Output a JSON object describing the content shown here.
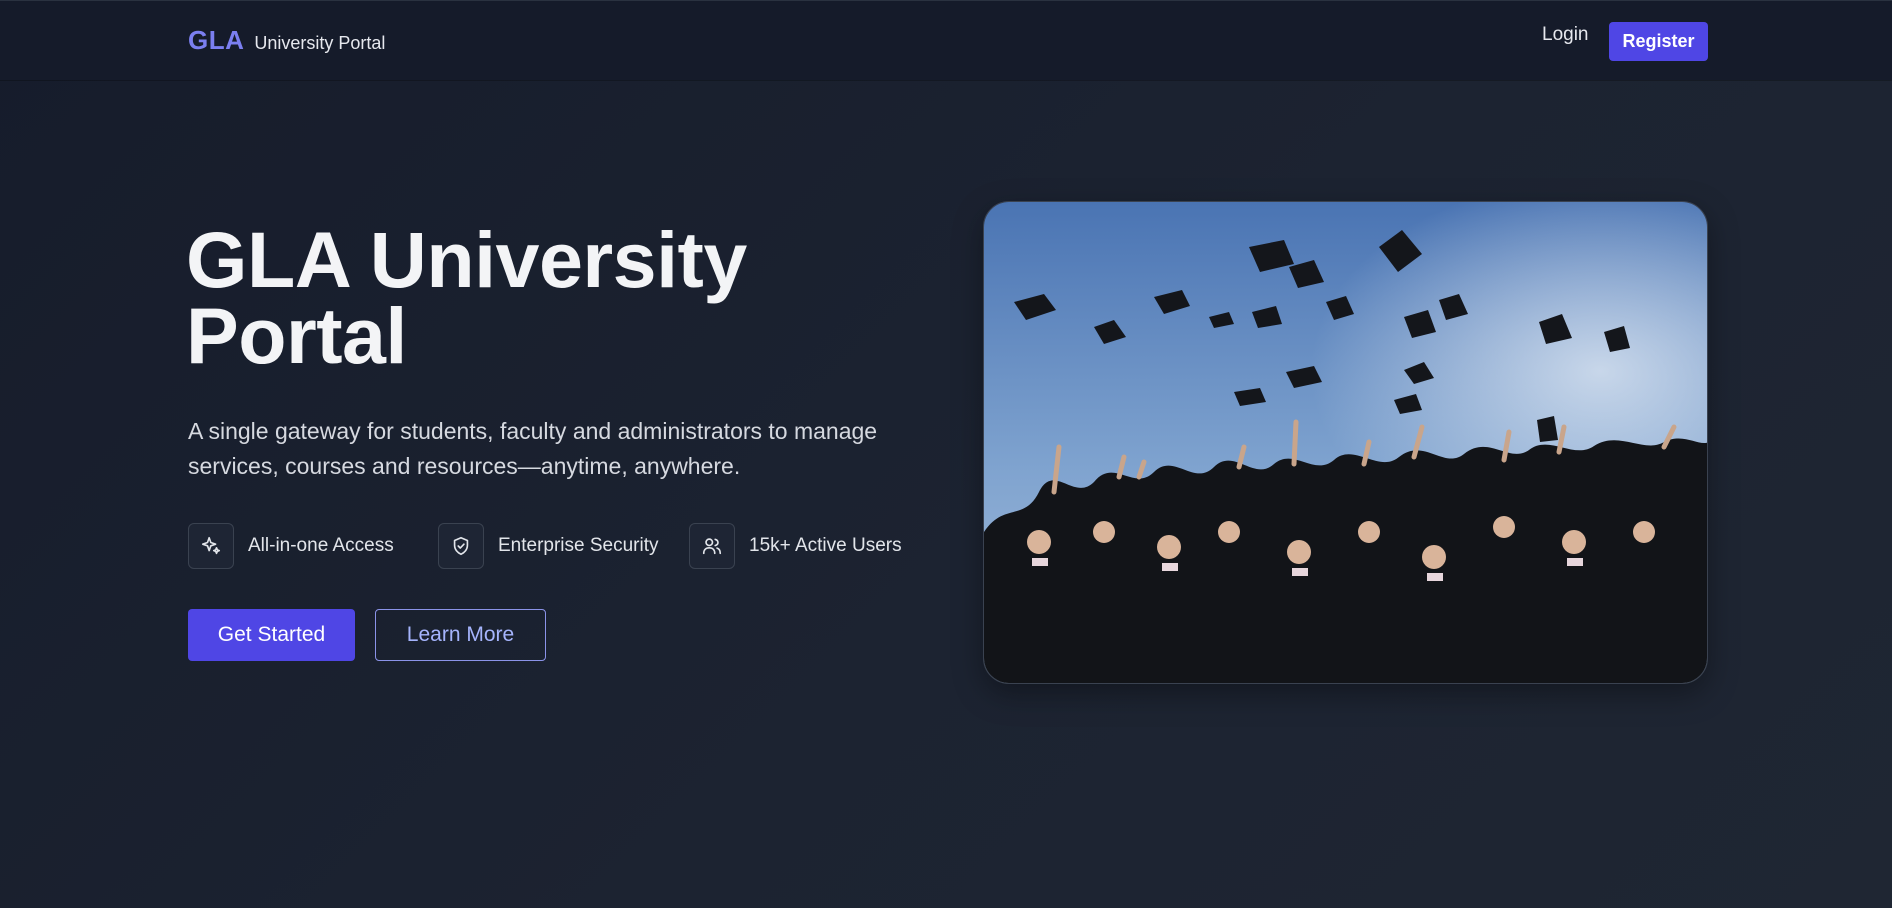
{
  "header": {
    "brand_mark": "GLA",
    "brand_name": "University Portal",
    "login_label": "Login",
    "register_label": "Register"
  },
  "hero": {
    "title_line1": "GLA University",
    "title_line2": "Portal",
    "subtitle_line1": "A single gateway for students, faculty and administrators to manage",
    "subtitle_line2": "services, courses and resources—anytime, anywhere.",
    "features": [
      {
        "icon": "sparkles-icon",
        "label": "All-in-one Access"
      },
      {
        "icon": "shield-check-icon",
        "label": "Enterprise Security"
      },
      {
        "icon": "users-icon",
        "label": "15k+ Active Users"
      }
    ],
    "primary_cta": "Get Started",
    "secondary_cta": "Learn More",
    "image": {
      "subject": "graduates throwing caps into the sky"
    }
  },
  "colors": {
    "accent": "#4f46e5",
    "brand": "#7b7ff0",
    "background": "#1a2030",
    "navbar": "#151b2a",
    "link_outline": "#8b93e8"
  }
}
